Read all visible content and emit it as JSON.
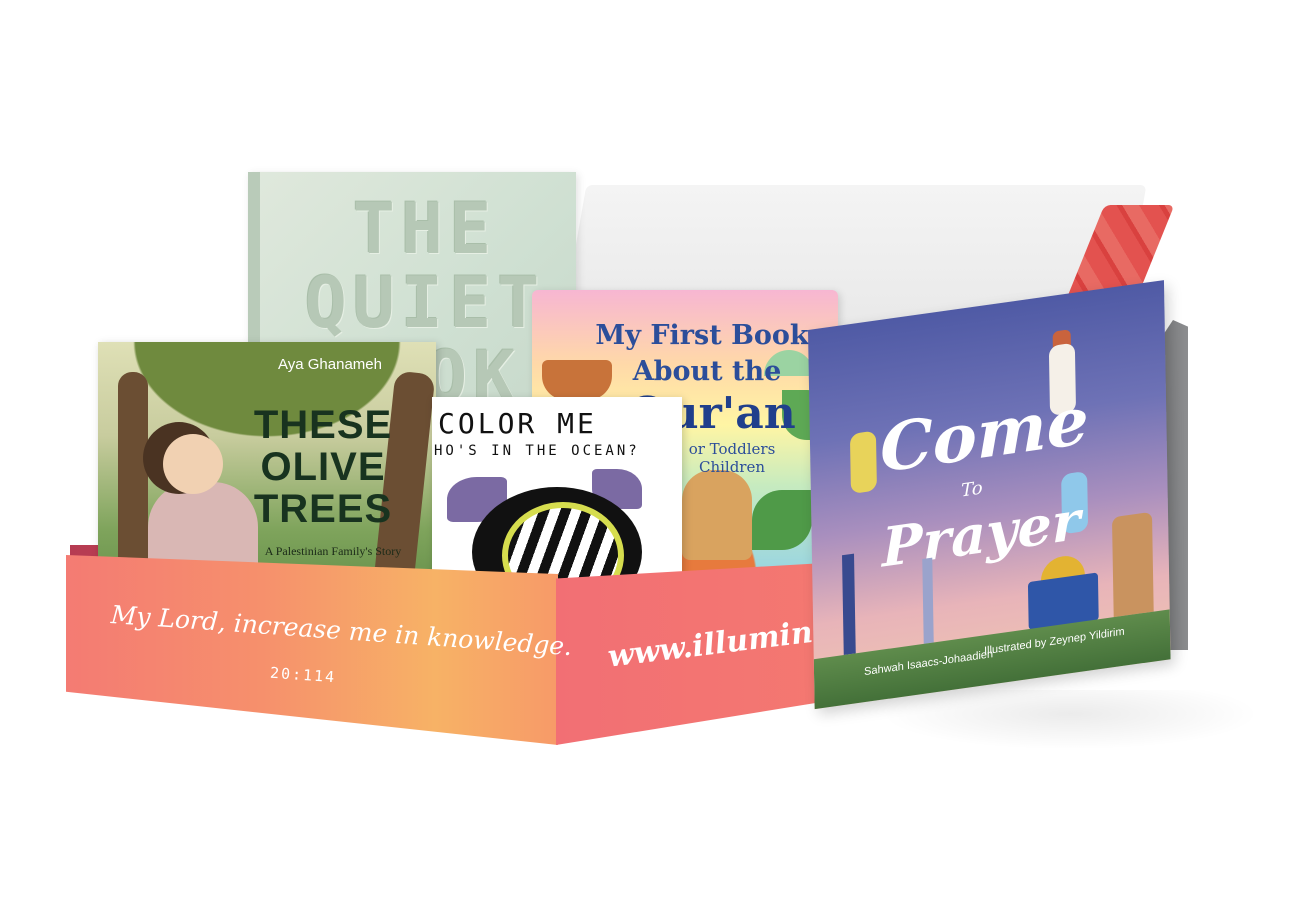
{
  "books": {
    "quiet_book": {
      "title": "THE QUIET BOOK"
    },
    "quran_book": {
      "title_line1": "My First Book",
      "title_line2": "About the",
      "title_line3": "Qur'an",
      "subtitle_line1": "or Toddlers",
      "subtitle_line2": "Children"
    },
    "olive_book": {
      "author": "Aya Ghanameh",
      "title": "THESE OLIVE TREES",
      "subtitle": "A Palestinian Family's Story"
    },
    "ocean_book": {
      "title_line1": "COLOR ME",
      "title_line2": "HO'S IN THE OCEAN?"
    },
    "prayer_book": {
      "title_line1": "Come",
      "title_line2": "To",
      "title_line3": "Prayer",
      "author": "Sahwah Isaacs-Johaadien",
      "illustrator": "Illustrated by Zeynep Yildirim"
    }
  },
  "box": {
    "verse": "My Lord, increase me in knowledge.",
    "verse_ref": "20:114",
    "url": "www.illuminatemu"
  },
  "colors": {
    "box_front": "#f47b73",
    "box_accent": "#f7b266",
    "lid_red": "#e3524f"
  }
}
